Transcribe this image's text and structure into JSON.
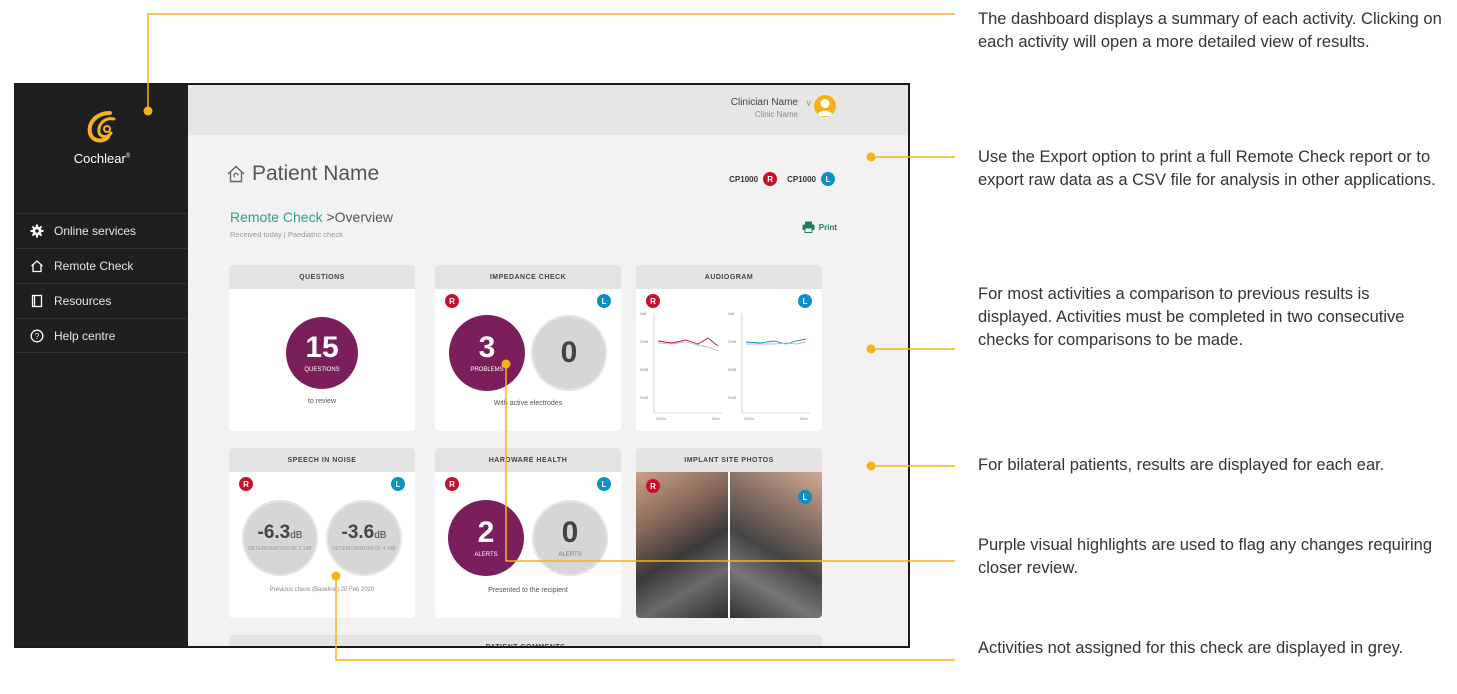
{
  "colors": {
    "accent": "#f5b21a",
    "purple": "#7a1f5c",
    "right_ear": "#c8102e",
    "left_ear": "#0d8fc4",
    "teal": "#2e9e8f"
  },
  "sidebar": {
    "brand": "Cochlear",
    "items": [
      {
        "label": "Online services",
        "icon": "gear-icon"
      },
      {
        "label": "Remote Check",
        "icon": "home-ear-icon"
      },
      {
        "label": "Resources",
        "icon": "book-icon"
      },
      {
        "label": "Help centre",
        "icon": "help-icon"
      }
    ]
  },
  "header": {
    "clinician_name": "Clinician Name",
    "clinic_name": "Clinic Name"
  },
  "patient": {
    "name": "Patient Name",
    "device_right": "CP1000",
    "device_left": "CP1000",
    "breadcrumb_section": "Remote Check",
    "breadcrumb_sep": ">",
    "breadcrumb_page": "Overview",
    "subtitle": "Received today | Paediatric check",
    "print_label": "Print",
    "right_letter": "R",
    "left_letter": "L"
  },
  "cards": {
    "questions": {
      "title": "QUESTIONS",
      "count": "15",
      "count_label": "QUESTIONS",
      "caption": "to review"
    },
    "impedance": {
      "title": "IMPEDANCE CHECK",
      "right_value": "3",
      "right_label": "PROBLEMS",
      "left_value": "0",
      "caption": "With active electrodes"
    },
    "audiogram": {
      "title": "AUDIOGRAM",
      "y_ticks": [
        "0dB",
        "30dB",
        "60dB",
        "90dB"
      ],
      "x_ticks": [
        "250Hz",
        "8kHz"
      ]
    },
    "speech": {
      "title": "SPEECH IN NOISE",
      "right_value": "-6.3",
      "right_unit": "dB",
      "right_label": "DETERIORATION OF 2.1dB",
      "left_value": "-3.6",
      "left_unit": "dB",
      "left_label": "DETERIORATION OF 4.7dB",
      "caption": "Previous check (Baseline) 20 Feb 2020"
    },
    "hardware": {
      "title": "HARDWARE HEALTH",
      "right_value": "2",
      "right_label": "ALERTS",
      "left_value": "0",
      "left_label": "ALERTS",
      "caption": "Presented to the recipient"
    },
    "photos": {
      "title": "IMPLANT SITE PHOTOS"
    },
    "comments": {
      "title": "PATIENT COMMENTS"
    }
  },
  "annotations": [
    "The dashboard displays a summary of each activity. Clicking on each activity will open a more detailed view of results.",
    "Use the Export option to print a full Remote Check report or to export raw data as a CSV file for analysis in other applications.",
    "For most activities a comparison to previous results is displayed. Activities must be completed in two consecutive checks for comparisons to be made.",
    "For bilateral patients, results are displayed for each ear.",
    "Purple visual highlights are used to flag any changes requiring closer review.",
    "Activities not assigned for this check are displayed in grey."
  ]
}
